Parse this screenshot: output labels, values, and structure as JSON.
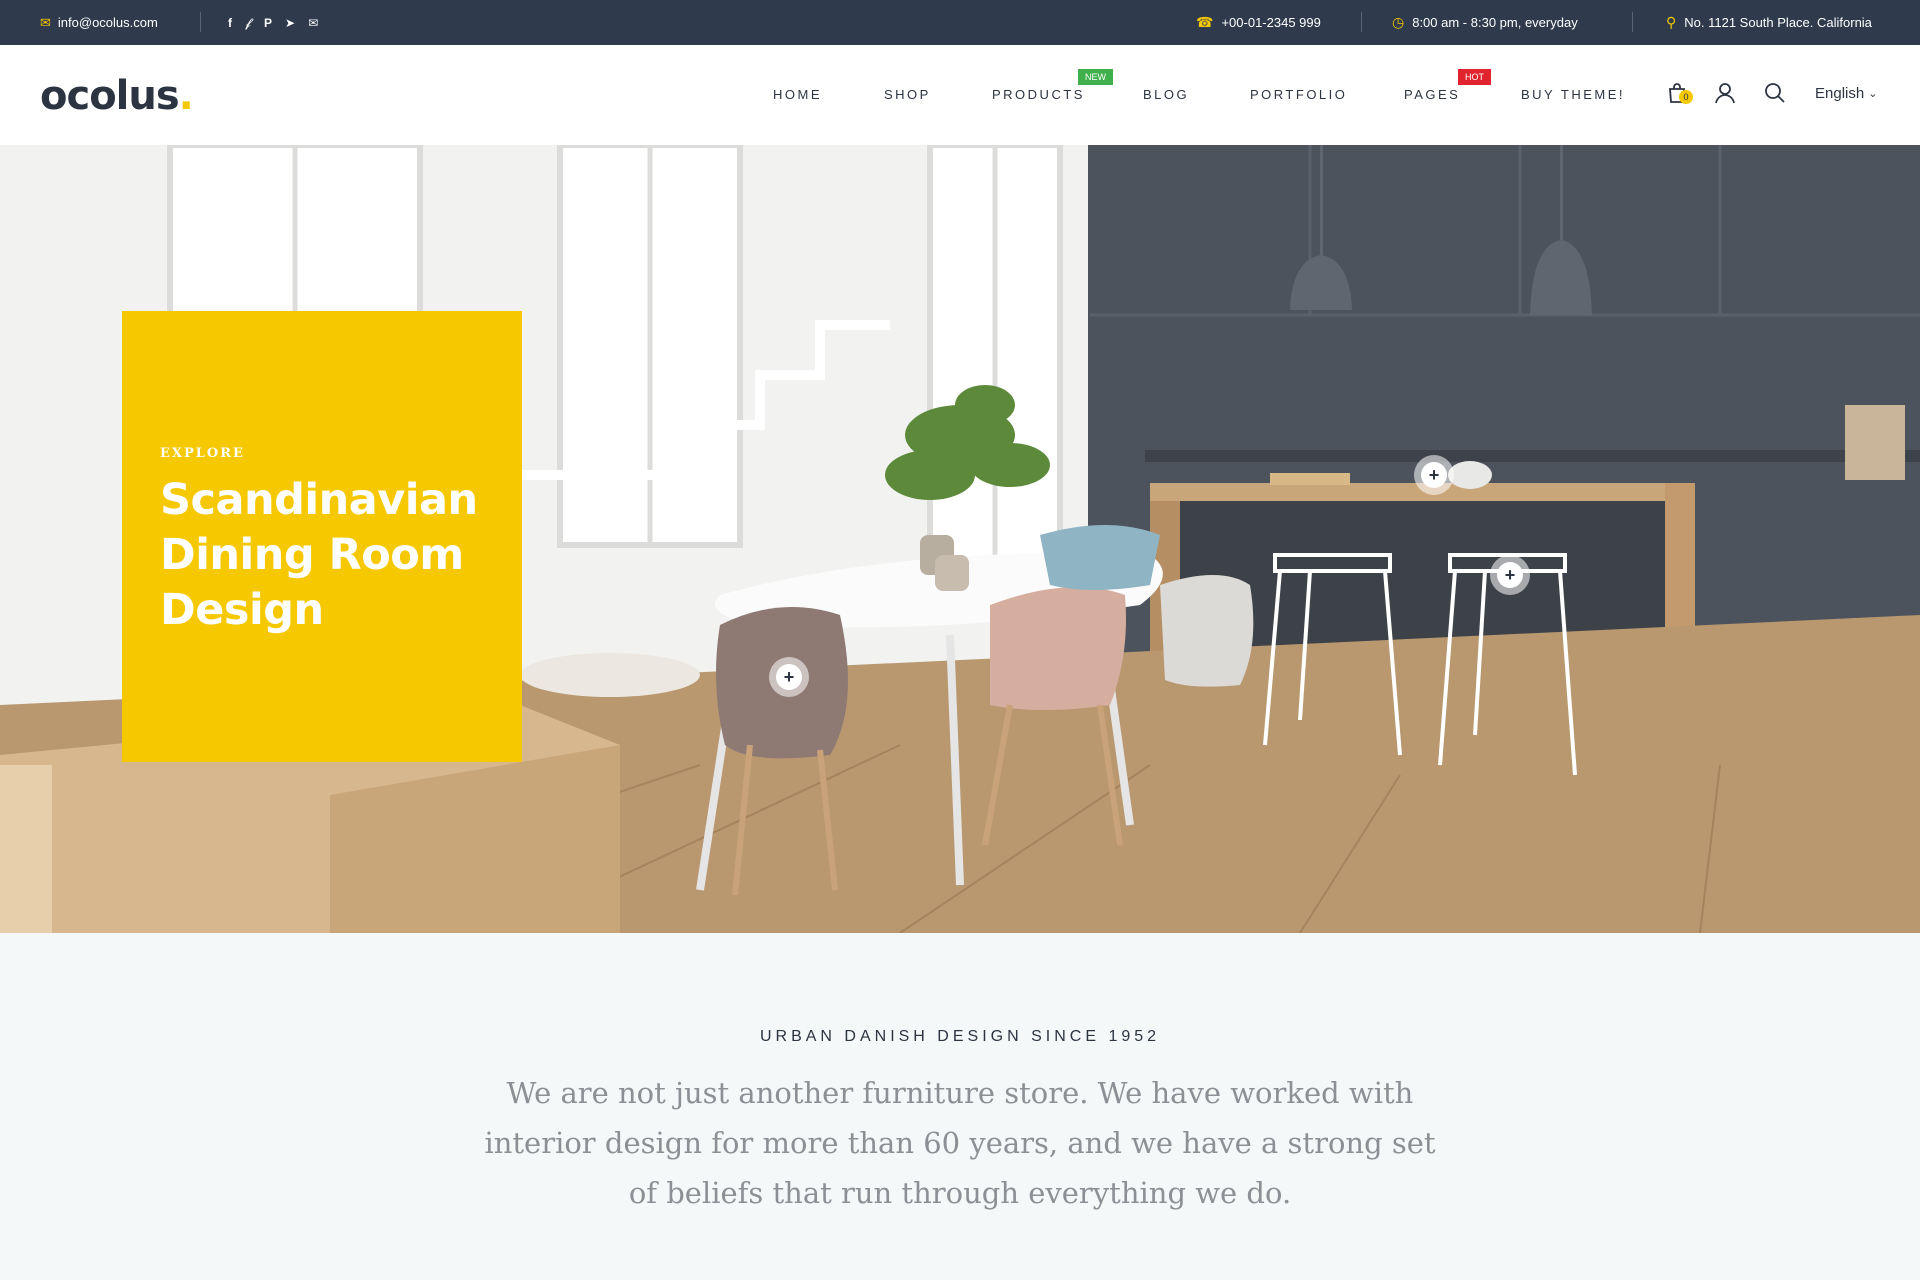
{
  "topbar": {
    "email": "info@ocolus.com",
    "socials": [
      "facebook-icon",
      "twitter-icon",
      "pinterest-icon",
      "telegram-icon",
      "envelope-icon"
    ],
    "phone": "+00-01-2345 999",
    "hours": "8:00 am - 8:30 pm, everyday",
    "address": "No. 1121 South Place. California"
  },
  "header": {
    "logo_text": "ocolus",
    "logo_dot": ".",
    "nav": [
      {
        "label": "HOME"
      },
      {
        "label": "SHOP"
      },
      {
        "label": "PRODUCTS",
        "badge": "NEW"
      },
      {
        "label": "BLOG"
      },
      {
        "label": "PORTFOLIO"
      },
      {
        "label": "PAGES",
        "badge": "HOT"
      },
      {
        "label": "BUY THEME!"
      }
    ],
    "cart_count": "0",
    "language": "English"
  },
  "hero": {
    "eyebrow": "EXPLORE",
    "title": "Scandinavian Dining Room Design"
  },
  "about": {
    "eyebrow": "URBAN DANISH DESIGN SINCE 1952",
    "text": "We are not just another furniture store. We have worked with interior design for more than 60 years, and we have a strong set of beliefs that run through everything we do."
  },
  "colors": {
    "topbar_bg": "#2f3a4c",
    "accent": "#f5c800",
    "badge_new": "#3fb04b",
    "badge_hot": "#e0232c",
    "page_bg": "#f5f8f9"
  }
}
